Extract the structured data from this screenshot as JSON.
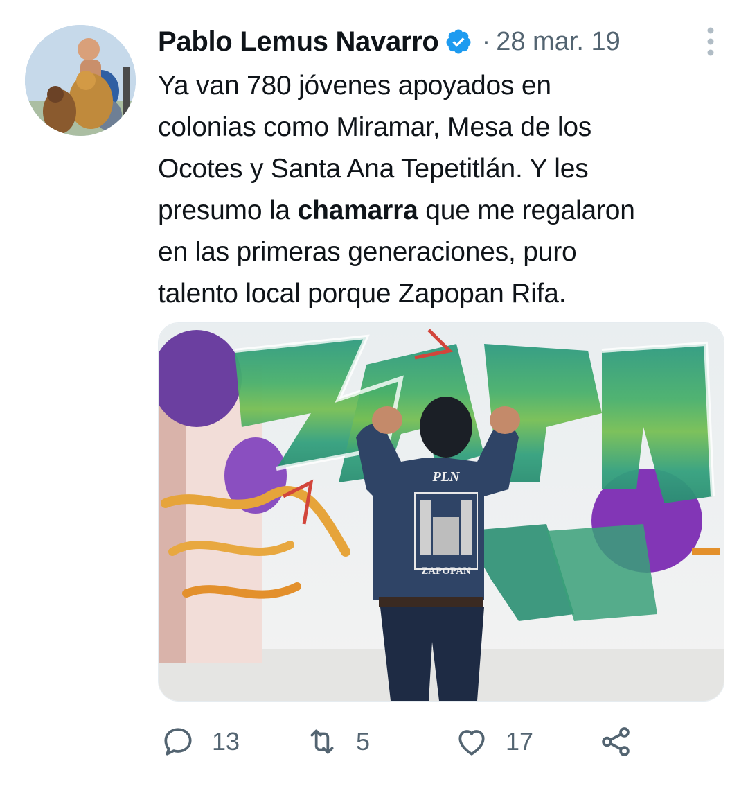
{
  "tweet": {
    "author": "Pablo Lemus Navarro",
    "date": "28 mar. 19",
    "text_lines": [
      "Ya van 780 jóvenes apoyados en",
      "colonias como Miramar, Mesa de los",
      "Ocotes y Santa Ana Tepetitlán. Y les",
      "presumo la",
      "chamarra",
      "que me regalaron",
      "en las primeras generaciones, puro",
      "talento local porque Zapopan Rifa."
    ],
    "media": {
      "jacket_top_text": "PLN",
      "jacket_bottom_text": "ZAPOPAN"
    },
    "actions": {
      "replies": "13",
      "retweets": "5",
      "likes": "17"
    }
  },
  "colors": {
    "text": "#0f1419",
    "muted": "#536471",
    "verified": "#1d9bf0",
    "graffiti_green": "#2f9e7a",
    "graffiti_purple": "#7b3ba8"
  },
  "icons": [
    "verified-badge-icon",
    "more-options-icon",
    "reply-icon",
    "retweet-icon",
    "like-icon",
    "share-icon"
  ]
}
